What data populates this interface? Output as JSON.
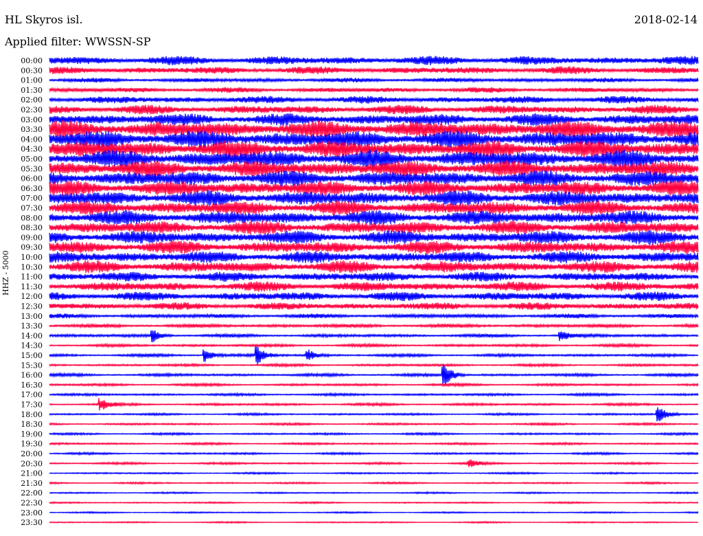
{
  "header": {
    "station": "HL Skyros isl.",
    "date": "2018-02-14",
    "filter": "Applied filter: WWSSN-SP"
  },
  "axis": {
    "ylabel": "HHZ - 5000"
  },
  "chart_data": {
    "type": "line",
    "title": "HL Skyros isl.",
    "subtitle": "Applied filter: WWSSN-SP",
    "ylabel": "HHZ - 5000",
    "grid": false,
    "colors": [
      "#0000ff",
      "#ff0040"
    ],
    "rows": [
      "00:00",
      "00:30",
      "01:00",
      "01:30",
      "02:00",
      "02:30",
      "03:00",
      "03:30",
      "04:00",
      "04:30",
      "05:00",
      "05:30",
      "06:00",
      "06:30",
      "07:00",
      "07:30",
      "08:00",
      "08:30",
      "09:00",
      "09:30",
      "10:00",
      "10:30",
      "11:00",
      "11:30",
      "12:00",
      "12:30",
      "13:00",
      "13:30",
      "14:00",
      "14:30",
      "15:00",
      "15:30",
      "16:00",
      "16:30",
      "17:00",
      "17:30",
      "18:00",
      "18:30",
      "19:00",
      "19:30",
      "20:00",
      "20:30",
      "21:00",
      "21:30",
      "22:00",
      "22:30",
      "23:00",
      "23:30"
    ],
    "noise_amplitude": [
      1.2,
      1.0,
      0.6,
      0.7,
      1.0,
      1.2,
      1.6,
      2.3,
      2.3,
      2.3,
      2.3,
      2.2,
      2.1,
      2.0,
      2.0,
      1.9,
      1.9,
      1.8,
      1.8,
      1.7,
      1.6,
      1.6,
      1.3,
      1.3,
      1.2,
      1.0,
      0.6,
      0.5,
      0.45,
      0.4,
      0.4,
      0.35,
      0.4,
      0.35,
      0.35,
      0.35,
      0.3,
      0.3,
      0.3,
      0.3,
      0.3,
      0.3,
      0.25,
      0.25,
      0.22,
      0.22,
      0.2,
      0.2
    ],
    "events": [
      {
        "row": "14:00",
        "x_fraction": 0.16,
        "amplitude": 1.4
      },
      {
        "row": "14:00",
        "x_fraction": 0.79,
        "amplitude": 1.1
      },
      {
        "row": "15:00",
        "x_fraction": 0.24,
        "amplitude": 1.6
      },
      {
        "row": "15:00",
        "x_fraction": 0.32,
        "amplitude": 2.2
      },
      {
        "row": "15:00",
        "x_fraction": 0.4,
        "amplitude": 1.2
      },
      {
        "row": "16:00",
        "x_fraction": 0.61,
        "amplitude": 2.6
      },
      {
        "row": "17:30",
        "x_fraction": 0.08,
        "amplitude": 1.3
      },
      {
        "row": "18:00",
        "x_fraction": 0.94,
        "amplitude": 1.8
      },
      {
        "row": "20:30",
        "x_fraction": 0.65,
        "amplitude": 0.8
      }
    ]
  }
}
